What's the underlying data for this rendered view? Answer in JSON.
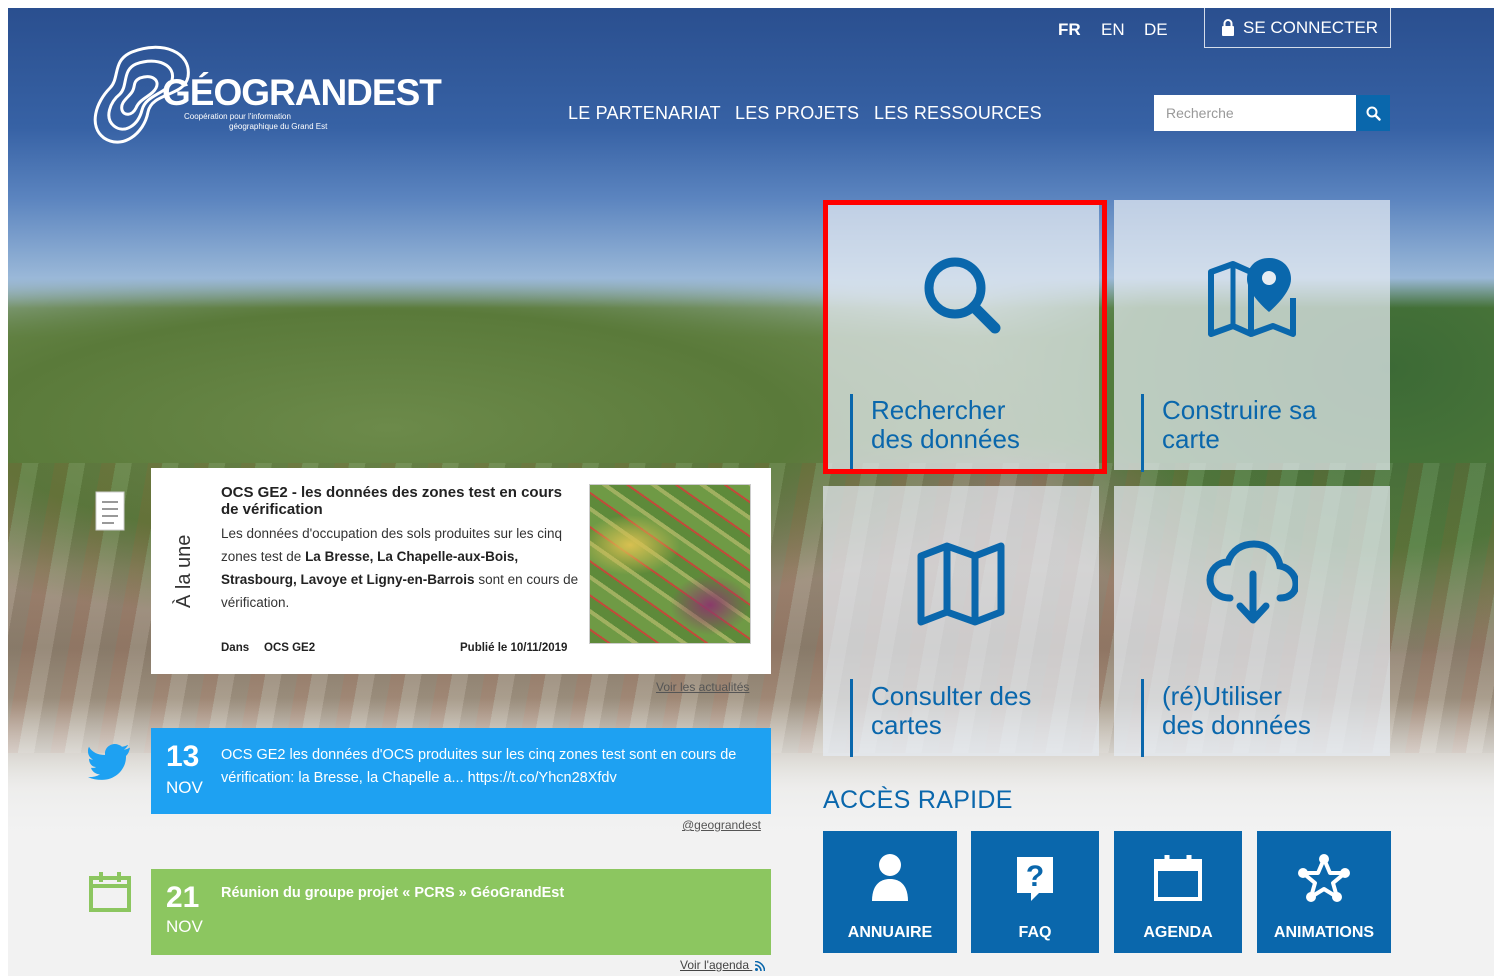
{
  "header": {
    "logo_main": "GÉOGRANDEST",
    "logo_sub_1": "Coopération pour l'information",
    "logo_sub_2": "géographique du Grand Est",
    "languages": [
      "FR",
      "EN",
      "DE"
    ],
    "login_label": "SE CONNECTER",
    "nav": [
      "LE PARTENARIAT",
      "LES PROJETS",
      "LES RESSOURCES"
    ],
    "search_placeholder": "Recherche"
  },
  "tiles": [
    {
      "line1": "Rechercher",
      "line2": "des données",
      "icon": "search-icon"
    },
    {
      "line1": "Construire sa",
      "line2": "carte",
      "icon": "map-pin-icon"
    },
    {
      "line1": "Consulter des",
      "line2": "cartes",
      "icon": "map-icon"
    },
    {
      "line1": "(ré)Utiliser",
      "line2": "des données",
      "icon": "cloud-download-icon"
    }
  ],
  "news": {
    "side_label": "À la une",
    "title": "OCS GE2 - les données des zones test en cours de vérification",
    "body_1": "Les données d'occupation des sols produites sur les cinq zones test de ",
    "body_places_1": "La Bresse, La Chapelle-aux-Bois, Strasbourg, Lavoye et Ligny-en-Barrois",
    "body_2": " sont en cours de vérification.",
    "category_label": "Dans",
    "category": "OCS GE2",
    "published": "Publié le 10/11/2019",
    "more_link": "Voir les actualités"
  },
  "tweet": {
    "day": "13",
    "month": "NOV",
    "text": "OCS GE2 les données d'OCS produites sur les cinq zones test sont en cours de vérification: la Bresse, la Chapelle a... ",
    "link": "https://t.co/Yhcn28Xfdv",
    "handle": "@geograndest"
  },
  "event": {
    "day": "21",
    "month": "NOV",
    "text": "Réunion du groupe projet « PCRS » GéoGrandEst",
    "agenda_link": "Voir l'agenda"
  },
  "quick_access": {
    "title": "ACCÈS RAPIDE",
    "items": [
      "ANNUAIRE",
      "FAQ",
      "AGENDA",
      "ANIMATIONS"
    ]
  },
  "colors": {
    "brand_blue": "#0a67ac",
    "twitter_blue": "#1ea1f2",
    "event_green": "#8cc660",
    "highlight_red": "#ff0000"
  }
}
